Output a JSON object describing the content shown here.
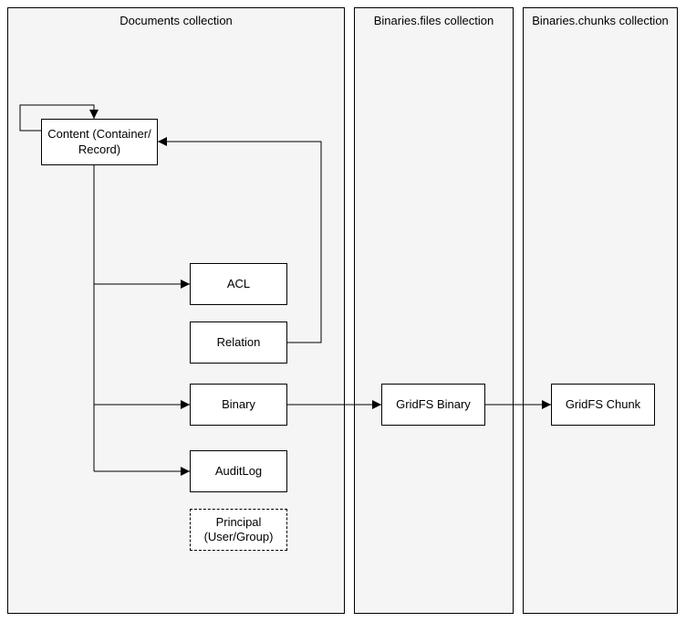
{
  "columns": {
    "documents": {
      "title": "Documents collection"
    },
    "binariesFiles": {
      "title": "Binaries.files collection"
    },
    "binariesChunks": {
      "title": "Binaries.chunks collection"
    }
  },
  "nodes": {
    "content": {
      "label": "Content (Container/\nRecord)"
    },
    "acl": {
      "label": "ACL"
    },
    "relation": {
      "label": "Relation"
    },
    "binary": {
      "label": "Binary"
    },
    "auditlog": {
      "label": "AuditLog"
    },
    "principal": {
      "label": "Principal\n(User/Group)"
    },
    "gridfsBinary": {
      "label": "GridFS Binary"
    },
    "gridfsChunk": {
      "label": "GridFS Chunk"
    }
  }
}
